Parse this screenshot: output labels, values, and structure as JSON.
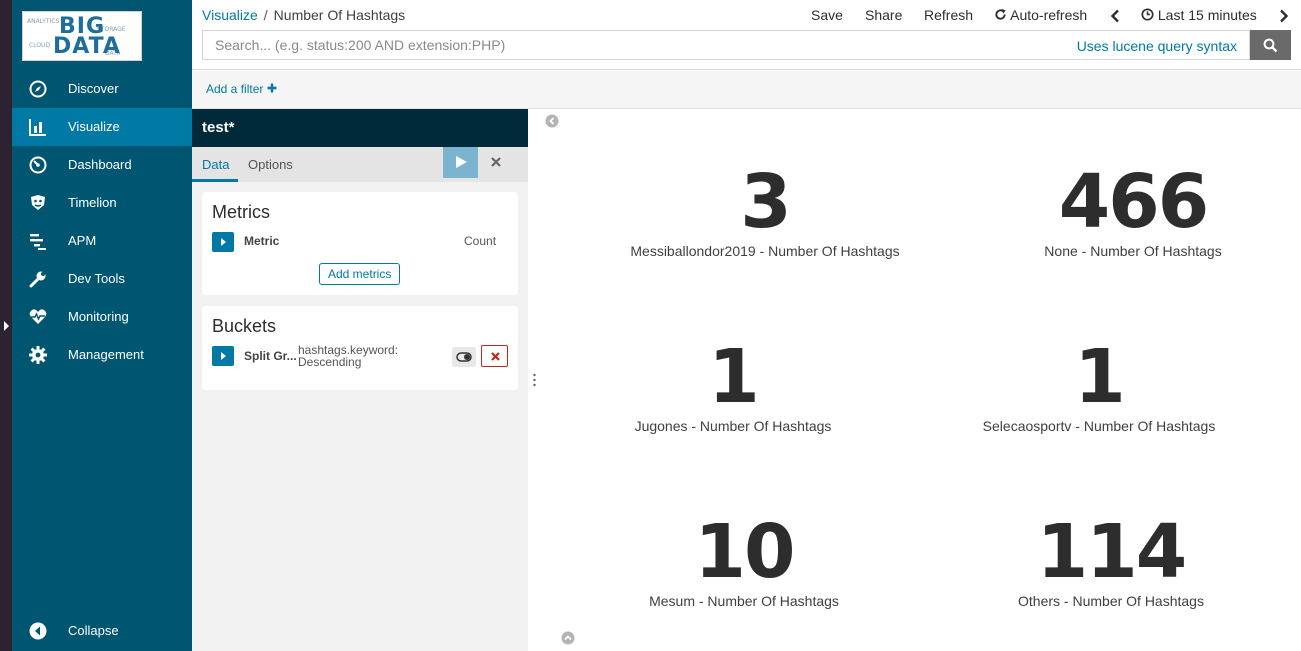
{
  "logo": {
    "word1": "BIG",
    "word2": "DATA",
    "deco": [
      "ANALYTICS",
      "STORAGE",
      "CLOUD",
      "DATA"
    ]
  },
  "nav": {
    "items": [
      {
        "label": "Discover",
        "icon": "compass-icon"
      },
      {
        "label": "Visualize",
        "icon": "bar-chart-icon"
      },
      {
        "label": "Dashboard",
        "icon": "gauge-icon"
      },
      {
        "label": "Timelion",
        "icon": "shield-face-icon"
      },
      {
        "label": "APM",
        "icon": "apm-bars-icon"
      },
      {
        "label": "Dev Tools",
        "icon": "wrench-icon"
      },
      {
        "label": "Monitoring",
        "icon": "heartbeat-icon"
      },
      {
        "label": "Management",
        "icon": "gear-icon"
      }
    ],
    "collapse": "Collapse"
  },
  "breadcrumb": {
    "parent": "Visualize",
    "separator": "/",
    "current": "Number Of Hashtags"
  },
  "topmenu": {
    "save": "Save",
    "share": "Share",
    "refresh": "Refresh",
    "auto_refresh": "Auto-refresh",
    "time_range": "Last 15 minutes"
  },
  "search": {
    "placeholder": "Search... (e.g. status:200 AND extension:PHP)",
    "value": "",
    "syntax_link": "Uses lucene query syntax"
  },
  "filter": {
    "add_label": "Add a filter"
  },
  "editor": {
    "title": "test*",
    "tabs": [
      "Data",
      "Options"
    ],
    "active_tab": "Data",
    "metrics": {
      "heading": "Metrics",
      "row_label": "Metric",
      "row_value": "Count",
      "add_button": "Add metrics"
    },
    "buckets": {
      "heading": "Buckets",
      "row_label": "Split Gr...",
      "row_desc_1": "hashtags.keyword:",
      "row_desc_2": "Descending"
    }
  },
  "metrics": [
    {
      "value": "3",
      "label": "Messiballondor2019 - Number Of Hashtags"
    },
    {
      "value": "466",
      "label": "None - Number Of Hashtags"
    },
    {
      "value": "1",
      "label": "Jugones - Number Of Hashtags"
    },
    {
      "value": "1",
      "label": "Selecaosportv - Number Of Hashtags"
    },
    {
      "value": "10",
      "label": "Mesum - Number Of Hashtags"
    },
    {
      "value": "114",
      "label": "Others - Number Of Hashtags"
    }
  ],
  "colors": {
    "sidebar": "#005571",
    "sidebar_active": "#0079a5",
    "accent": "#0079a5",
    "editor_title": "#002a3a",
    "danger": "#bd271e"
  }
}
